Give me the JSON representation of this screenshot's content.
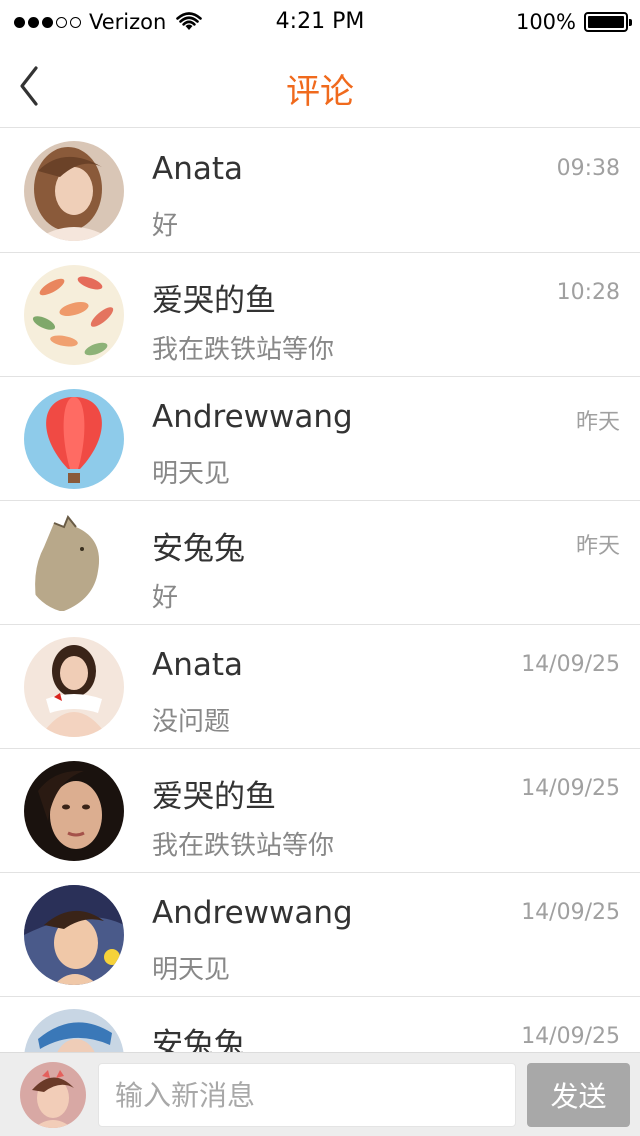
{
  "status_bar": {
    "carrier": "Verizon",
    "time": "4:21 PM",
    "battery": "100%",
    "signal_bars": 3,
    "signal_total": 5
  },
  "nav": {
    "title": "评论",
    "back_icon": "chevron-left-icon",
    "title_color": "#f06a1d"
  },
  "comments": [
    {
      "name": "Anata",
      "message": "好",
      "time": "09:38"
    },
    {
      "name": "爱哭的鱼",
      "message": "我在跌铁站等你",
      "time": "10:28"
    },
    {
      "name": "Andrewwang",
      "message": "明天见",
      "time": "昨天"
    },
    {
      "name": "安兔兔",
      "message": "好",
      "time": "昨天"
    },
    {
      "name": "Anata",
      "message": "没问题",
      "time": "14/09/25"
    },
    {
      "name": "爱哭的鱼",
      "message": "我在跌铁站等你",
      "time": "14/09/25"
    },
    {
      "name": "Andrewwang",
      "message": "明天见",
      "time": "14/09/25"
    },
    {
      "name": "安兔兔",
      "message": "",
      "time": "14/09/25"
    }
  ],
  "input_bar": {
    "placeholder": "输入新消息",
    "send_label": "发送"
  }
}
